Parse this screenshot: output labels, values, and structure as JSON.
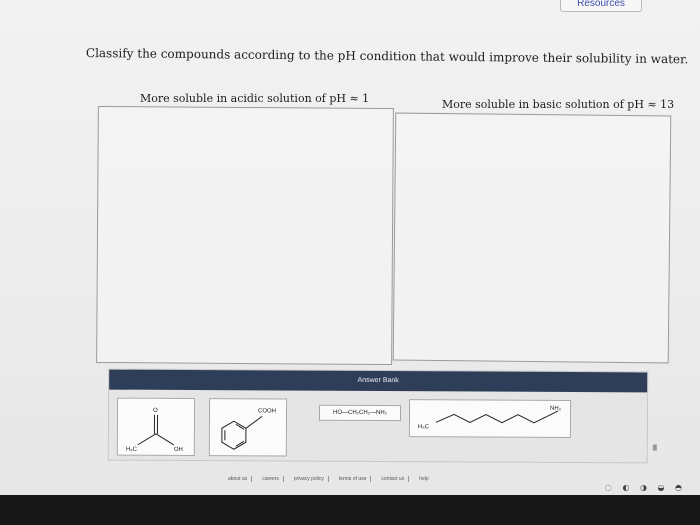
{
  "header": {
    "resources_label": "Resources"
  },
  "question": {
    "instruction": "Classify the compounds according to the pH condition that would improve their solubility in water."
  },
  "bins": {
    "acidic_label": "More soluble in acidic solution of pH ≈ 1",
    "basic_label": "More soluble in basic solution of pH ≈ 13"
  },
  "answer_bank": {
    "title": "Answer Bank",
    "items": [
      {
        "o": "O",
        "h3c": "H₃C",
        "oh": "OH"
      },
      {
        "cooh": "COOH"
      },
      {
        "formula": "HO—CH₂CH₂—NH₂"
      },
      {
        "h3c": "H₃C",
        "nh2": "NH₂"
      }
    ]
  },
  "footer": {
    "links": [
      "about us",
      "careers",
      "privacy policy",
      "terms of use",
      "contact us",
      "help"
    ]
  },
  "colors": {
    "bank_header": "#2f3e58",
    "resources_link": "#3a4fb0"
  }
}
